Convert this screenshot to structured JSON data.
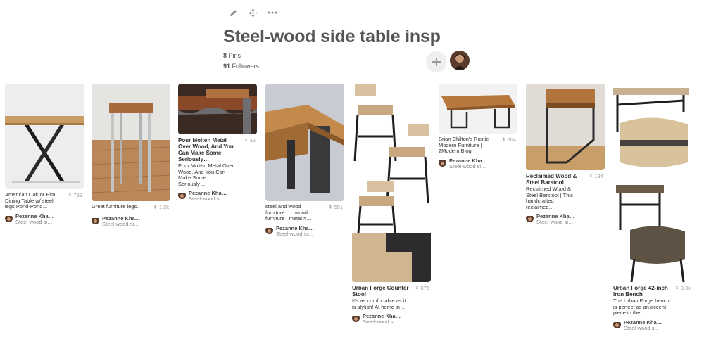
{
  "board": {
    "title": "Steel-wood side table insp",
    "pins_count": "8",
    "pins_label": "Pins",
    "followers_count": "91",
    "followers_label": "Followers"
  },
  "toolbar": {
    "icons": [
      "pencil-icon",
      "move-icon",
      "more-icon"
    ]
  },
  "colors": {
    "repin_gray": "#a0a0a0",
    "title_gray": "#555555",
    "add_button_bg": "#efefef"
  },
  "pins": [
    {
      "title": "",
      "description": "American Oak or Elm Dining Table w/ steel legs Pond-Pond…",
      "repins": "783",
      "author": "Pezanne Kha…",
      "board": "Steel-wood si…"
    },
    {
      "title": "",
      "description": "Great furniture legs.",
      "repins": "1.2k",
      "author": "Pezanne Kha…",
      "board": "Steel-wood si…"
    },
    {
      "title": "Pour Molten Metal Over Wood, And You Can Make Some Seriously…",
      "description": "Pour Molten Metal Over Wood, And You Can Make Some Seriously…",
      "repins": "36",
      "author": "Pezanne Kha…",
      "board": "Steel-wood si…"
    },
    {
      "title": "",
      "description": "steel and wood furniture | ... wood furniture | metal #…",
      "repins": "551",
      "author": "Pezanne Kha…",
      "board": "Steel-wood si…"
    },
    {
      "title": "Urban Forge Counter Stool",
      "description": "It's as comfortable as it is stylish! At home in…",
      "repins": "676",
      "author": "Pezanne Kha…",
      "board": "Steel-wood si…"
    },
    {
      "title": "",
      "description": "Brian Chilton's Rustic Modern Furniture | 2Modern Blog",
      "repins": "504",
      "author": "Pezanne Kha…",
      "board": "Steel-wood si…"
    },
    {
      "title": "Reclaimed Wood & Steel Barstool",
      "description": "Reclaimed Wood & Steel Barstool | This handcrafted reclaimed…",
      "repins": "134",
      "author": "Pezanne Kha…",
      "board": "Steel-wood si…"
    },
    {
      "title": "Urban Forge 42-inch Iron Bench",
      "description": "The Urban Forge bench is perfect as an accent piece in the…",
      "repins": "9.3k",
      "author": "Pezanne Kha…",
      "board": "Steel-wood si…"
    }
  ]
}
